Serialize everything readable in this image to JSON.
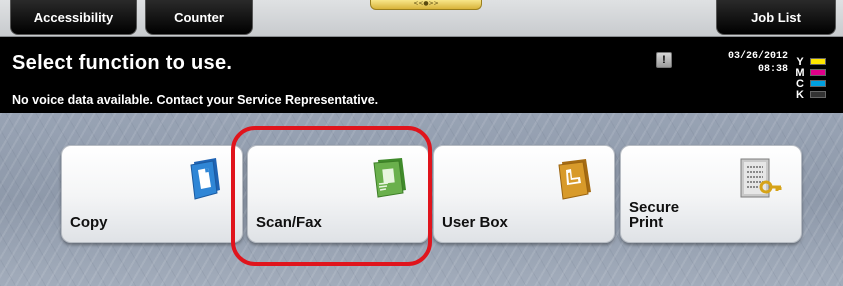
{
  "top_bar": {
    "handle_glyph": "<<●>>",
    "tabs": {
      "accessibility": "Accessibility",
      "counter": "Counter",
      "job_list": "Job List"
    }
  },
  "status": {
    "title": "Select function to use.",
    "message": "No voice data available. Contact your Service Representative.",
    "warning_icon": "!",
    "date": "03/26/2012",
    "time": "08:38",
    "toner": [
      {
        "letter": "Y",
        "color": "#ffe600"
      },
      {
        "letter": "M",
        "color": "#e0008a"
      },
      {
        "letter": "C",
        "color": "#00a0e0"
      },
      {
        "letter": "K",
        "color": "#333333"
      }
    ]
  },
  "functions": [
    {
      "label": "Copy",
      "icon": "copy-icon",
      "color": "#2a78c8"
    },
    {
      "label": "Scan/Fax",
      "icon": "scan-fax-icon",
      "color": "#5aa03a"
    },
    {
      "label": "User Box",
      "icon": "user-box-icon",
      "color": "#c98a1e"
    },
    {
      "label": "Secure\nPrint",
      "icon": "secure-print-icon",
      "color": "#9a9a9a"
    }
  ],
  "highlight": {
    "color": "#e0141c"
  }
}
